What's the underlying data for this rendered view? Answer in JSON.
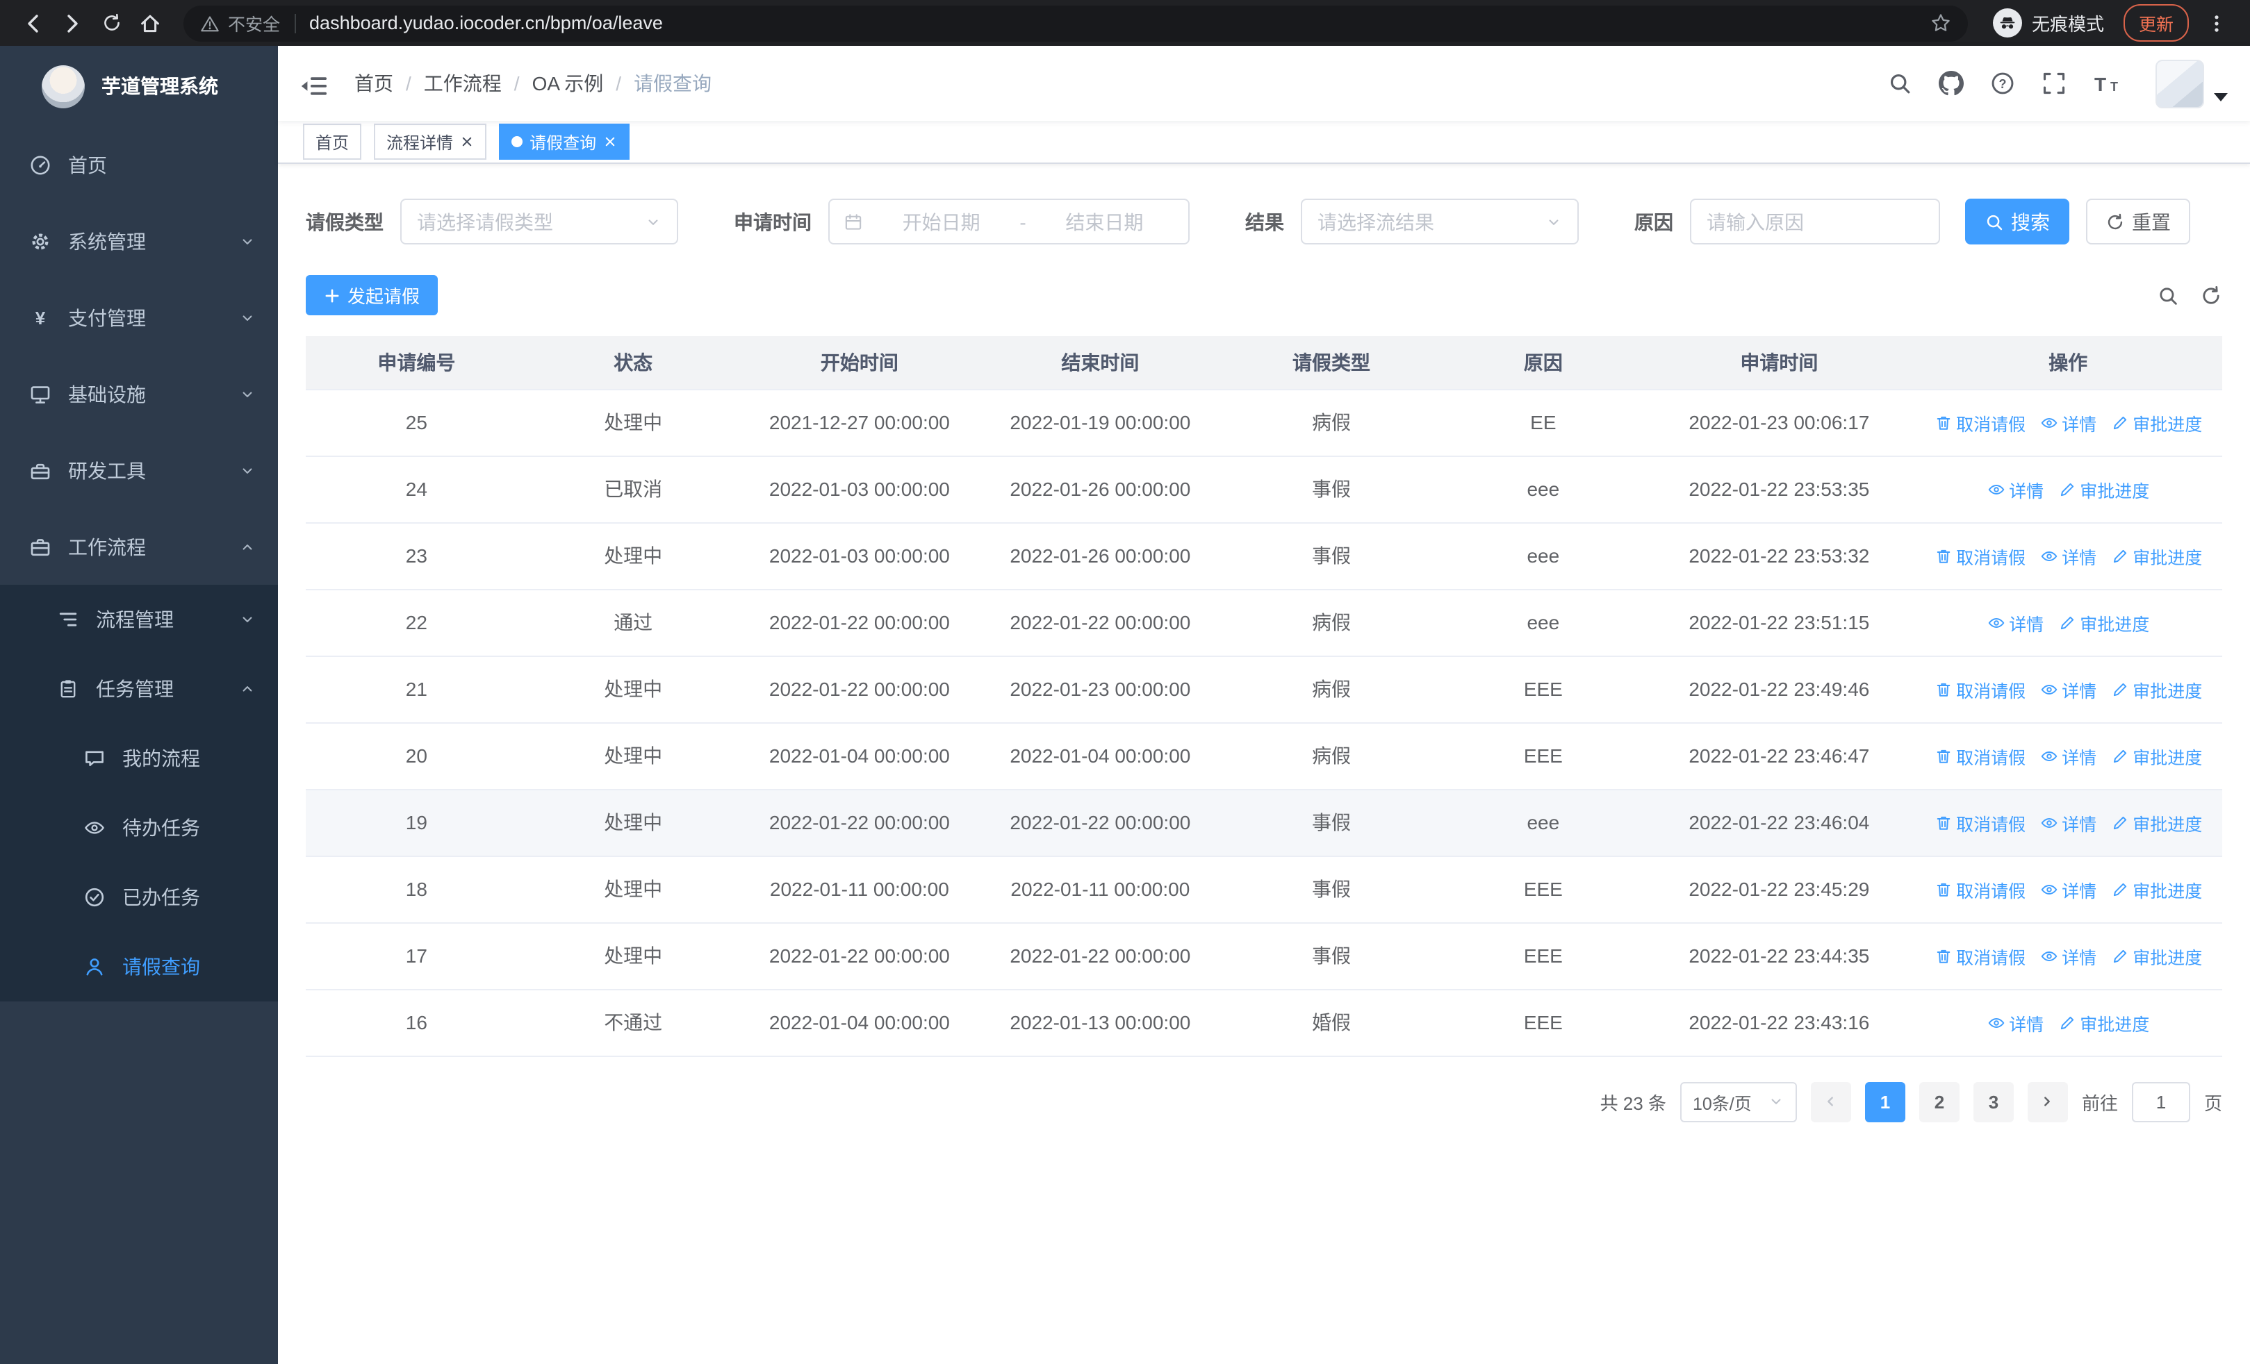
{
  "browser": {
    "security_label": "不安全",
    "url": "dashboard.yudao.iocoder.cn/bpm/oa/leave",
    "incognito_label": "无痕模式",
    "update_label": "更新"
  },
  "sidebar": {
    "logo_title": "芋道管理系统",
    "items": [
      {
        "key": "home",
        "label": "首页",
        "icon": "dashboard-icon",
        "depth": 0
      },
      {
        "key": "system-mgmt",
        "label": "系统管理",
        "icon": "gear-icon",
        "depth": 0,
        "chevron": "down"
      },
      {
        "key": "payment-mgmt",
        "label": "支付管理",
        "icon": "yen-icon",
        "depth": 0,
        "chevron": "down"
      },
      {
        "key": "infrastructure",
        "label": "基础设施",
        "icon": "monitor-icon",
        "depth": 0,
        "chevron": "down"
      },
      {
        "key": "dev-tools",
        "label": "研发工具",
        "icon": "toolbox-icon",
        "depth": 0,
        "chevron": "down"
      },
      {
        "key": "workflow",
        "label": "工作流程",
        "icon": "briefcase-icon",
        "depth": 0,
        "chevron": "up"
      },
      {
        "key": "process-mgmt",
        "label": "流程管理",
        "icon": "tree-list-icon",
        "depth": 1,
        "chevron": "down"
      },
      {
        "key": "task-mgmt",
        "label": "任务管理",
        "icon": "clipboard-icon",
        "depth": 1,
        "chevron": "up"
      },
      {
        "key": "my-process",
        "label": "我的流程",
        "icon": "chat-icon",
        "depth": 2
      },
      {
        "key": "todo-tasks",
        "label": "待办任务",
        "icon": "eye-icon",
        "depth": 2
      },
      {
        "key": "done-tasks",
        "label": "已办任务",
        "icon": "done-icon",
        "depth": 2
      },
      {
        "key": "leave-query",
        "label": "请假查询",
        "icon": "user-icon",
        "depth": 2,
        "active": true
      }
    ]
  },
  "header": {
    "breadcrumb": [
      "首页",
      "工作流程",
      "OA 示例",
      "请假查询"
    ]
  },
  "tabs": [
    {
      "key": "home",
      "label": "首页",
      "active": false,
      "closable": false,
      "dot": false
    },
    {
      "key": "process-detail",
      "label": "流程详情",
      "active": false,
      "closable": true,
      "dot": false
    },
    {
      "key": "leave-query",
      "label": "请假查询",
      "active": true,
      "closable": true,
      "dot": true
    }
  ],
  "filters": {
    "leave_type_label": "请假类型",
    "leave_type_placeholder": "请选择请假类型",
    "apply_time_label": "申请时间",
    "start_date_placeholder": "开始日期",
    "date_separator": "-",
    "end_date_placeholder": "结束日期",
    "result_label": "结果",
    "result_placeholder": "请选择流结果",
    "reason_label": "原因",
    "reason_placeholder": "请输入原因",
    "search_label": "搜索",
    "reset_label": "重置"
  },
  "toolbar": {
    "create_label": "发起请假"
  },
  "table": {
    "headers": [
      "申请编号",
      "状态",
      "开始时间",
      "结束时间",
      "请假类型",
      "原因",
      "申请时间",
      "操作"
    ],
    "action_defs": {
      "cancel": {
        "label": "取消请假",
        "icon": "delete-icon"
      },
      "detail": {
        "label": "详情",
        "icon": "eye-icon"
      },
      "progress": {
        "label": "审批进度",
        "icon": "edit-icon"
      }
    },
    "rows": [
      {
        "id": "25",
        "status": "处理中",
        "start_time": "2021-12-27 00:00:00",
        "end_time": "2022-01-19 00:00:00",
        "leave_type": "病假",
        "reason": "EE",
        "apply_time": "2022-01-23 00:06:17",
        "actions": [
          "cancel",
          "detail",
          "progress"
        ]
      },
      {
        "id": "24",
        "status": "已取消",
        "start_time": "2022-01-03 00:00:00",
        "end_time": "2022-01-26 00:00:00",
        "leave_type": "事假",
        "reason": "eee",
        "apply_time": "2022-01-22 23:53:35",
        "actions": [
          "detail",
          "progress"
        ]
      },
      {
        "id": "23",
        "status": "处理中",
        "start_time": "2022-01-03 00:00:00",
        "end_time": "2022-01-26 00:00:00",
        "leave_type": "事假",
        "reason": "eee",
        "apply_time": "2022-01-22 23:53:32",
        "actions": [
          "cancel",
          "detail",
          "progress"
        ]
      },
      {
        "id": "22",
        "status": "通过",
        "start_time": "2022-01-22 00:00:00",
        "end_time": "2022-01-22 00:00:00",
        "leave_type": "病假",
        "reason": "eee",
        "apply_time": "2022-01-22 23:51:15",
        "actions": [
          "detail",
          "progress"
        ]
      },
      {
        "id": "21",
        "status": "处理中",
        "start_time": "2022-01-22 00:00:00",
        "end_time": "2022-01-23 00:00:00",
        "leave_type": "病假",
        "reason": "EEE",
        "apply_time": "2022-01-22 23:49:46",
        "actions": [
          "cancel",
          "detail",
          "progress"
        ]
      },
      {
        "id": "20",
        "status": "处理中",
        "start_time": "2022-01-04 00:00:00",
        "end_time": "2022-01-04 00:00:00",
        "leave_type": "病假",
        "reason": "EEE",
        "apply_time": "2022-01-22 23:46:47",
        "actions": [
          "cancel",
          "detail",
          "progress"
        ]
      },
      {
        "id": "19",
        "status": "处理中",
        "start_time": "2022-01-22 00:00:00",
        "end_time": "2022-01-22 00:00:00",
        "leave_type": "事假",
        "reason": "eee",
        "apply_time": "2022-01-22 23:46:04",
        "actions": [
          "cancel",
          "detail",
          "progress"
        ],
        "highlighted": true
      },
      {
        "id": "18",
        "status": "处理中",
        "start_time": "2022-01-11 00:00:00",
        "end_time": "2022-01-11 00:00:00",
        "leave_type": "事假",
        "reason": "EEE",
        "apply_time": "2022-01-22 23:45:29",
        "actions": [
          "cancel",
          "detail",
          "progress"
        ]
      },
      {
        "id": "17",
        "status": "处理中",
        "start_time": "2022-01-22 00:00:00",
        "end_time": "2022-01-22 00:00:00",
        "leave_type": "事假",
        "reason": "EEE",
        "apply_time": "2022-01-22 23:44:35",
        "actions": [
          "cancel",
          "detail",
          "progress"
        ]
      },
      {
        "id": "16",
        "status": "不通过",
        "start_time": "2022-01-04 00:00:00",
        "end_time": "2022-01-13 00:00:00",
        "leave_type": "婚假",
        "reason": "EEE",
        "apply_time": "2022-01-22 23:43:16",
        "actions": [
          "detail",
          "progress"
        ]
      }
    ]
  },
  "pagination": {
    "total_label": "共 23 条",
    "page_size_label": "10条/页",
    "pages": [
      "1",
      "2",
      "3"
    ],
    "active_page": "1",
    "goto_label": "前往",
    "goto_value": "1",
    "goto_suffix": "页"
  },
  "colors": {
    "primary": "#409eff",
    "sidebar_bg": "#2d3a4b",
    "sidebar_submenu_bg": "#1f2d3d",
    "sidebar_text": "#bfcbd9",
    "chrome_bg": "#202124",
    "update_accent": "#ef7152",
    "table_header_bg": "#f2f3f5"
  }
}
